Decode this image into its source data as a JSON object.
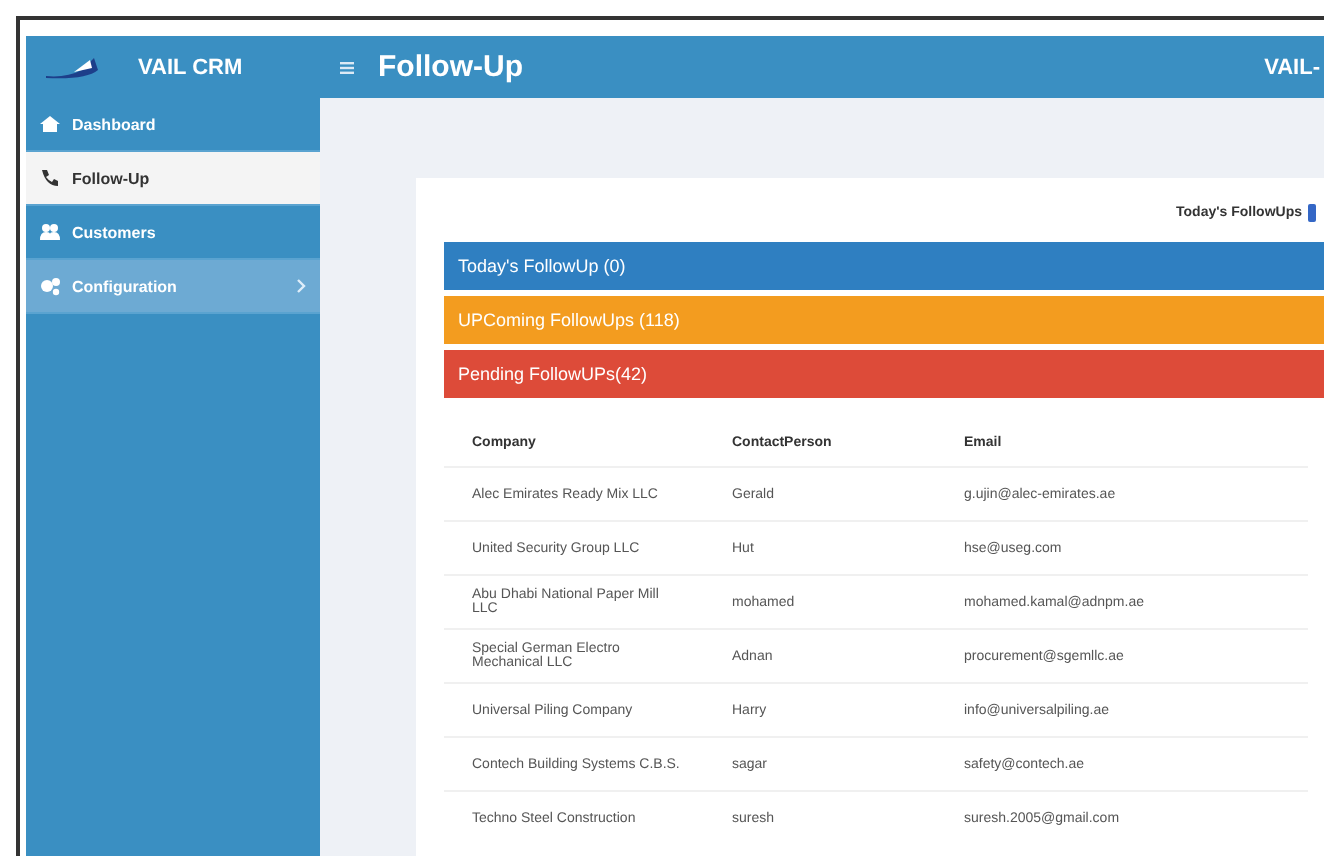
{
  "topbar": {
    "app_name": "VAIL CRM",
    "page_title": "Follow-Up",
    "user": "VAIL-"
  },
  "sidebar": {
    "items": [
      {
        "label": "Dashboard",
        "selected": false,
        "kind": "link"
      },
      {
        "label": "Follow-Up",
        "selected": true,
        "kind": "link"
      },
      {
        "label": "Customers",
        "selected": false,
        "kind": "link"
      },
      {
        "label": "Configuration",
        "selected": false,
        "kind": "group"
      }
    ]
  },
  "card": {
    "legend": "Today's FollowUps",
    "panels": [
      {
        "label": "Today's FollowUp (0)",
        "color": "#2f7fc1"
      },
      {
        "label": "UPComing FollowUps (118)",
        "color": "#f39c1f"
      },
      {
        "label": "Pending FollowUPs(42)",
        "color": "#dd4b39"
      }
    ],
    "table": {
      "columns": [
        "Company",
        "ContactPerson",
        "Email"
      ],
      "rows": [
        [
          "Alec Emirates Ready Mix LLC",
          "Gerald",
          "g.ujin@alec-emirates.ae"
        ],
        [
          "United Security Group LLC",
          "Hut",
          "hse@useg.com"
        ],
        [
          "Abu Dhabi National Paper Mill LLC",
          "mohamed",
          "mohamed.kamal@adnpm.ae"
        ],
        [
          "Special German Electro Mechanical LLC",
          "Adnan",
          "procurement@sgemllc.ae"
        ],
        [
          "Universal Piling Company",
          "Harry",
          "info@universalpiling.ae"
        ],
        [
          "Contech Building Systems C.B.S.",
          "sagar",
          "safety@contech.ae"
        ],
        [
          "Techno Steel Construction",
          "suresh",
          "suresh.2005@gmail.com"
        ]
      ]
    }
  }
}
